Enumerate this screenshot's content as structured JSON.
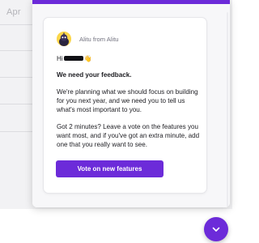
{
  "background": {
    "month_label": "Apr"
  },
  "panel": {
    "accent_color": "#6c2bd9",
    "message": {
      "sender_name": "Alitu from Alitu",
      "avatar_icon": "alitu-avatar-icon",
      "greeting": "Hi",
      "greeting_emoji": "👋",
      "heading": "We need your feedback.",
      "paragraph_1": "We're planning what we should focus on building for you next year, and we need you to tell us what's most important to you.",
      "paragraph_2": "Got 2 minutes? Leave a vote on the features you want most, and if you've got an extra minute, add one that you really want to see.",
      "cta_label": "Vote on new features"
    }
  },
  "launcher": {
    "icon": "chevron-down-icon"
  }
}
